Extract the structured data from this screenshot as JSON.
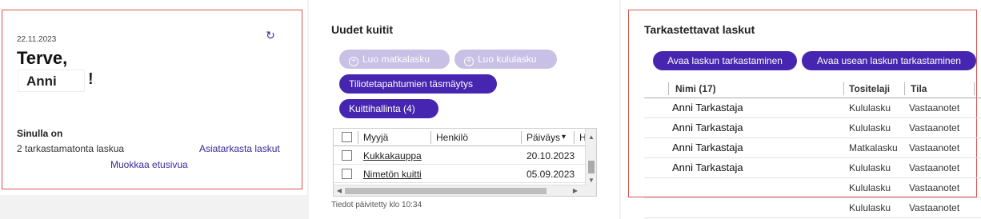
{
  "welcome": {
    "date": "22.11.2023",
    "greeting": "Terve,",
    "name": "Anni",
    "exclamation": "!",
    "you_have": "Sinulla on",
    "unchecked": "2 tarkastamatonta laskua",
    "check_link": "Asiatarkasta laskut",
    "edit_link": "Muokkaa etusivua",
    "refresh_icon": "refresh-icon"
  },
  "receipts": {
    "title": "Uudet kuitit",
    "btn_travel": "Luo matkalasku",
    "btn_expense": "Luo kululasku",
    "btn_match": "Tiliotetapahtumien täsmäytys",
    "btn_receipts": "Kuittihallinta (4)",
    "columns": [
      "Myyjä",
      "Henkilö",
      "Päiväys",
      "Hin"
    ],
    "rows": [
      {
        "seller": "Kukkakauppa",
        "person": "",
        "date": "20.10.2023"
      },
      {
        "seller": "Nimetön kuitti",
        "person": "",
        "date": "05.09.2023"
      }
    ],
    "sort_arrow": "▾",
    "updated": "Tiedot päivitetty klo 10:34"
  },
  "review": {
    "title": "Tarkastettavat laskut",
    "btn_open": "Avaa laskun tarkastaminen",
    "btn_open_many": "Avaa usean laskun tarkastaminen",
    "columns": [
      "Nimi (17)",
      "Tositelaji",
      "Tila"
    ],
    "rows": [
      {
        "name": "Anni Tarkastaja",
        "type": "Kululasku",
        "status": "Vastaanotet"
      },
      {
        "name": "Anni Tarkastaja",
        "type": "Kululasku",
        "status": "Vastaanotet"
      },
      {
        "name": "Anni Tarkastaja",
        "type": "Matkalasku",
        "status": "Vastaanotet"
      },
      {
        "name": "Anni Tarkastaja",
        "type": "Kululasku",
        "status": "Vastaanotet"
      },
      {
        "name": "",
        "type": "Kululasku",
        "status": "Vastaanotet"
      },
      {
        "name": "",
        "type": "Kululasku",
        "status": "Vastaanotet"
      }
    ]
  },
  "colors": {
    "accent": "#4626b0",
    "disabled": "#c9c0e6",
    "link": "#3b2a9a",
    "highlight": "#d9534f"
  }
}
